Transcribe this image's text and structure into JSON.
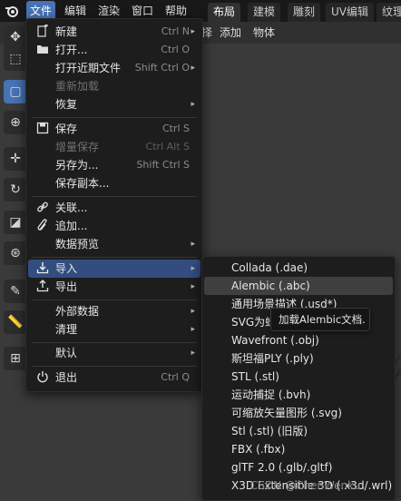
{
  "top_menu": {
    "items": [
      "文件",
      "编辑",
      "渲染",
      "窗口",
      "帮助"
    ],
    "active": "文件"
  },
  "workspace_tabs": [
    "布局",
    "建模",
    "雕刻",
    "UV编辑",
    "纹理"
  ],
  "viewport_header": [
    "择",
    "添加",
    "物体"
  ],
  "file_menu": {
    "items": [
      {
        "label": "新建",
        "shortcut": "Ctrl N",
        "arrow": true,
        "icon": "new-file-icon"
      },
      {
        "label": "打开...",
        "shortcut": "Ctrl O",
        "icon": "folder-icon"
      },
      {
        "label": "打开近期文件",
        "shortcut": "Shift Ctrl O",
        "arrow": true
      },
      {
        "label": "重新加载",
        "shortcut": "",
        "disabled": true
      },
      {
        "label": "恢复",
        "shortcut": "",
        "arrow": true
      },
      {
        "label": "保存",
        "shortcut": "Ctrl S",
        "icon": "save-icon"
      },
      {
        "label": "增量保存",
        "shortcut": "Ctrl Alt S",
        "disabled": true
      },
      {
        "label": "另存为...",
        "shortcut": "Shift Ctrl S"
      },
      {
        "label": "保存副本...",
        "shortcut": ""
      },
      {
        "label": "关联...",
        "shortcut": "",
        "icon": "link-icon"
      },
      {
        "label": "追加...",
        "shortcut": "",
        "icon": "paperclip-icon"
      },
      {
        "label": "数据预览",
        "shortcut": "",
        "arrow": true
      },
      {
        "label": "导入",
        "shortcut": "",
        "arrow": true,
        "highlighted": true,
        "icon": "import-icon"
      },
      {
        "label": "导出",
        "shortcut": "",
        "arrow": true,
        "icon": "export-icon"
      },
      {
        "label": "外部数据",
        "shortcut": "",
        "arrow": true
      },
      {
        "label": "清理",
        "shortcut": "",
        "arrow": true
      },
      {
        "label": "默认",
        "shortcut": "",
        "arrow": true
      },
      {
        "label": "退出",
        "shortcut": "Ctrl Q",
        "icon": "power-icon"
      }
    ]
  },
  "import_submenu": {
    "items": [
      {
        "label": "Collada (.dae)"
      },
      {
        "label": "Alembic (.abc)",
        "highlighted": true
      },
      {
        "label": "通用场景描述 (.usd*)"
      },
      {
        "label": "SVG为蜡"
      },
      {
        "label": "Wavefront (.obj)"
      },
      {
        "label": "斯坦福PLY (.ply)"
      },
      {
        "label": "STL (.stl)"
      },
      {
        "label": "运动捕捉 (.bvh)"
      },
      {
        "label": "可缩放矢量图形 (.svg)"
      },
      {
        "label": "Stl (.stl) (旧版)"
      },
      {
        "label": "FBX (.fbx)"
      },
      {
        "label": "glTF 2.0 (.glb/.gltf)"
      },
      {
        "label": "X3D Extensible 3D (.x3d/.wrl)"
      }
    ]
  },
  "tooltip": "加载Alembic文档.",
  "watermark": "CSDN @ChenWenku",
  "colors": {
    "accent": "#4772b3",
    "menu_bg": "#1d1d1d",
    "highlight": "#334d80"
  }
}
